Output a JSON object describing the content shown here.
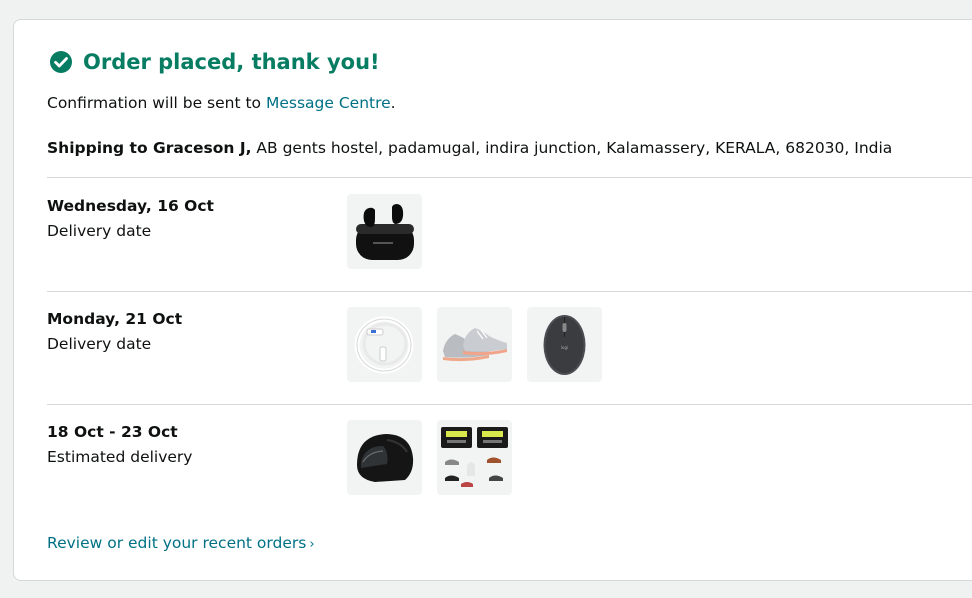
{
  "header": {
    "title": "Order placed, thank you!"
  },
  "confirmation": {
    "prefix": "Confirmation will be sent to ",
    "link": "Message Centre",
    "suffix": "."
  },
  "shipping": {
    "label": "Shipping to Graceson J,",
    "address": " AB gents hostel, padamugal, indira junction, Kalamassery, KERALA, 682030, India"
  },
  "deliveries": [
    {
      "date": "Wednesday, 16 Oct",
      "label": "Delivery date",
      "items": [
        "earbuds-icon"
      ]
    },
    {
      "date": "Monday, 21 Oct",
      "label": "Delivery date",
      "items": [
        "cable-icon",
        "shoe-icon",
        "mouse-icon"
      ]
    },
    {
      "date": "18 Oct - 23 Oct",
      "label": "Estimated delivery",
      "items": [
        "helmet-icon",
        "shoe-cleaner-icon"
      ]
    }
  ],
  "footer": {
    "review_link": "Review or edit your recent orders",
    "chevron": "›"
  },
  "colors": {
    "success_green": "#067d62",
    "link_teal": "#007185",
    "divider": "#d5d9d9"
  }
}
